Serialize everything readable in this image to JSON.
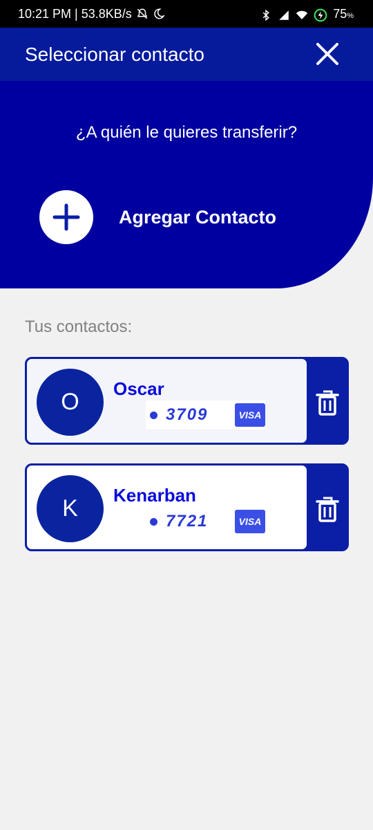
{
  "status_bar": {
    "time_speed": "10:21 PM | 53.8KB/s",
    "battery": "75",
    "battery_unit": "%"
  },
  "header": {
    "title": "Seleccionar contacto",
    "close_icon": "close-icon"
  },
  "hero": {
    "question": "¿A quién le quieres transferir?",
    "add_label": "Agregar Contacto",
    "add_icon": "plus-icon"
  },
  "contacts": {
    "heading": "Tus contactos:",
    "items": [
      {
        "initial": "O",
        "name": "Oscar",
        "card": "3709",
        "brand": "VISA",
        "background": "#f4f5fa"
      },
      {
        "initial": "K",
        "name": "Kenarban",
        "card": "7721",
        "brand": "VISA",
        "background": "#ffffff"
      }
    ]
  },
  "colors": {
    "app_bar": "#061a9c",
    "hero": "#0000a0",
    "name_text": "#0a0adb",
    "card_accent": "#2a3ad6",
    "visa": "#3b4fe6",
    "page_bg": "#f1f1f1"
  }
}
